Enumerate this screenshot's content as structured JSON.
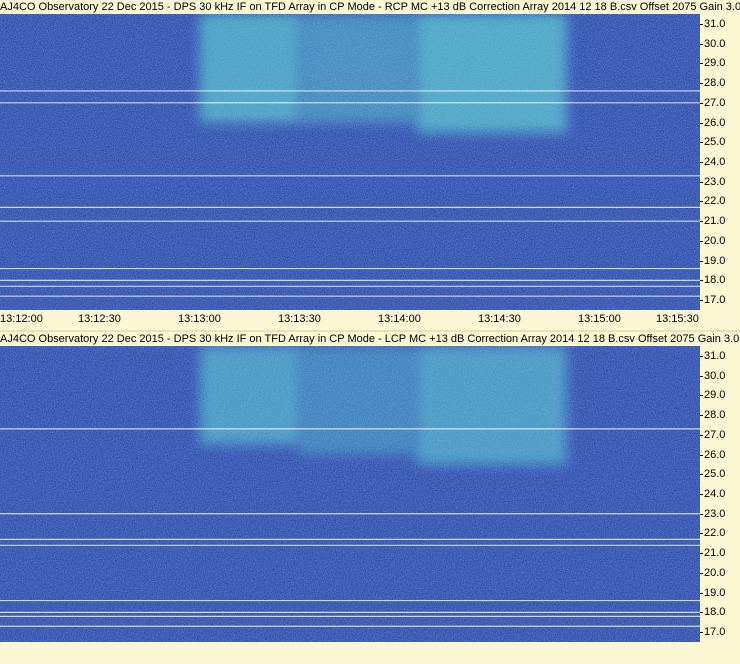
{
  "chart_data": [
    {
      "type": "heatmap",
      "title": "AJ4CO Observatory 22 Dec 2015 - DPS 30 kHz IF on TFD Array in CP Mode - RCP  MC +13 dB  Correction Array 2014 12 18 B.csv  Offset 2075  Gain 3.0",
      "x_ticks": [
        "13:12:00",
        "13:12:30",
        "13:13:00",
        "13:13:30",
        "13:14:00",
        "13:14:30",
        "13:15:00",
        "13:15:30"
      ],
      "y_ticks": [
        "31.0",
        "30.0",
        "29.0",
        "28.0",
        "27.0",
        "26.0",
        "25.0",
        "24.0",
        "23.0",
        "22.0",
        "21.0",
        "20.0",
        "19.0",
        "18.0",
        "17.0"
      ],
      "xlim": [
        "13:12:00",
        "13:15:30"
      ],
      "ylim": [
        16.5,
        31.5
      ],
      "burst_regions": [
        {
          "t_start": "13:13:00",
          "t_end": "13:13:30",
          "f_low": 26.0,
          "f_high": 31.5,
          "intensity": 0.85
        },
        {
          "t_start": "13:13:30",
          "t_end": "13:14:05",
          "f_low": 26.0,
          "f_high": 31.5,
          "intensity": 0.6
        },
        {
          "t_start": "13:14:05",
          "t_end": "13:14:50",
          "f_low": 25.5,
          "f_high": 31.5,
          "intensity": 0.9
        }
      ],
      "interference_lines_mhz": [
        27.6,
        27.0,
        23.3,
        21.7,
        21.0,
        18.6,
        18.0,
        17.7,
        17.2
      ],
      "colors": {
        "background": "#1c3a9c",
        "burst": "#4fe0c8",
        "line": "#ffffff"
      }
    },
    {
      "type": "heatmap",
      "title": "AJ4CO Observatory 22 Dec 2015 - DPS 30 kHz IF on TFD Array in CP Mode - LCP  MC +13 dB  Correction Array 2014 12 18 B.csv  Offset 2075  Gain 3.0",
      "x_ticks": [],
      "y_ticks": [
        "31.0",
        "30.0",
        "29.0",
        "28.0",
        "27.0",
        "26.0",
        "25.0",
        "24.0",
        "23.0",
        "22.0",
        "21.0",
        "20.0",
        "19.0",
        "18.0",
        "17.0"
      ],
      "xlim": [
        "13:12:00",
        "13:15:30"
      ],
      "ylim": [
        16.5,
        31.5
      ],
      "burst_regions": [
        {
          "t_start": "13:13:00",
          "t_end": "13:13:30",
          "f_low": 26.5,
          "f_high": 31.5,
          "intensity": 0.75
        },
        {
          "t_start": "13:13:30",
          "t_end": "13:14:05",
          "f_low": 26.0,
          "f_high": 31.5,
          "intensity": 0.5
        },
        {
          "t_start": "13:14:05",
          "t_end": "13:14:50",
          "f_low": 25.5,
          "f_high": 31.5,
          "intensity": 0.75
        }
      ],
      "interference_lines_mhz": [
        27.3,
        23.0,
        21.7,
        21.4,
        18.6,
        18.0,
        17.8,
        17.3
      ],
      "colors": {
        "background": "#1c3a9c",
        "burst": "#4fe0c8",
        "line": "#ffffff"
      }
    }
  ]
}
